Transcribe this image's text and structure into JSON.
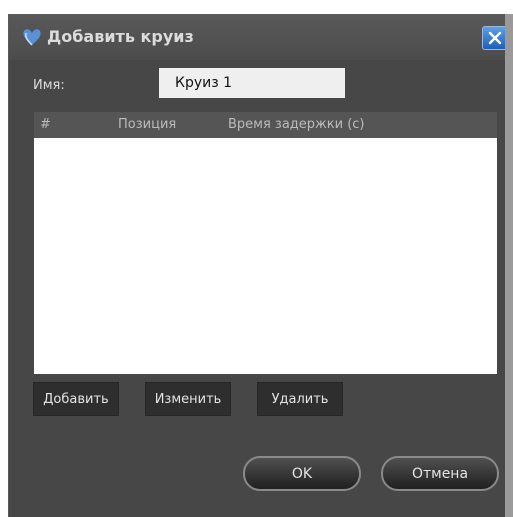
{
  "dialog": {
    "title": "Добавить круиз",
    "close_icon": "close-icon",
    "app_icon": "heart-icon"
  },
  "name_field": {
    "label": "Имя:",
    "value": "Круиз 1"
  },
  "table": {
    "columns": [
      "#",
      "Позиция",
      "Время задержки (с)"
    ],
    "rows": []
  },
  "buttons": {
    "add": "Добавить",
    "edit": "Изменить",
    "delete": "Удалить",
    "ok": "OK",
    "cancel": "Отмена"
  },
  "colors": {
    "dialog_bg": "#474747",
    "close_button": "#2f74d0"
  }
}
